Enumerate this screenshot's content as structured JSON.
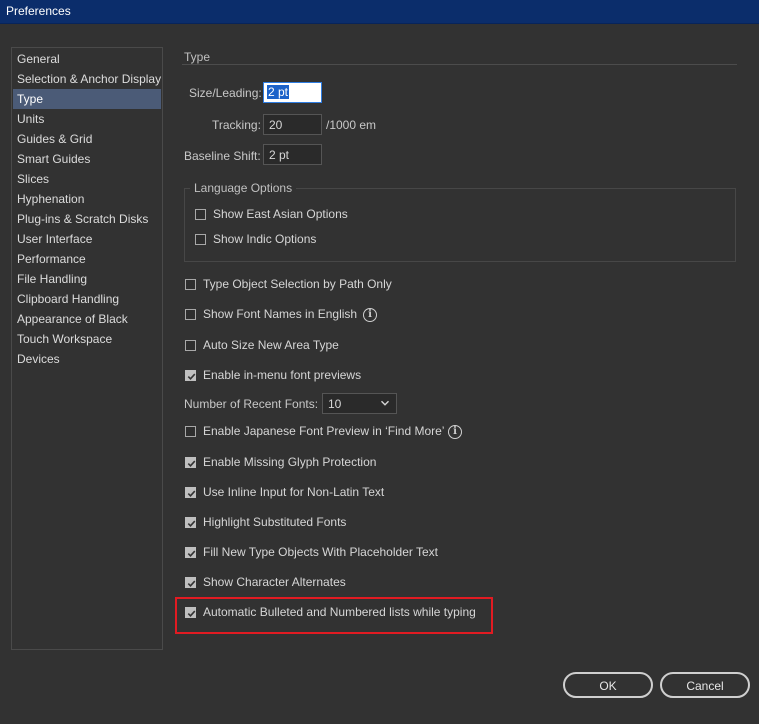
{
  "window": {
    "title": "Preferences"
  },
  "sidebar": {
    "items": [
      {
        "label": "General"
      },
      {
        "label": "Selection & Anchor Display"
      },
      {
        "label": "Type"
      },
      {
        "label": "Units"
      },
      {
        "label": "Guides & Grid"
      },
      {
        "label": "Smart Guides"
      },
      {
        "label": "Slices"
      },
      {
        "label": "Hyphenation"
      },
      {
        "label": "Plug-ins & Scratch Disks"
      },
      {
        "label": "User Interface"
      },
      {
        "label": "Performance"
      },
      {
        "label": "File Handling"
      },
      {
        "label": "Clipboard Handling"
      },
      {
        "label": "Appearance of Black"
      },
      {
        "label": "Touch Workspace"
      },
      {
        "label": "Devices"
      }
    ],
    "selected": "Type"
  },
  "type_section": {
    "title": "Type",
    "size_leading": {
      "label": "Size/Leading:",
      "value": "2 pt"
    },
    "tracking": {
      "label": "Tracking:",
      "value": "20",
      "unit": "/1000 em"
    },
    "baseline_shift": {
      "label": "Baseline Shift:",
      "value": "2 pt"
    }
  },
  "language_options": {
    "title": "Language Options",
    "east_asian": {
      "label": "Show East Asian Options",
      "checked": false
    },
    "indic": {
      "label": "Show Indic Options",
      "checked": false
    }
  },
  "options": {
    "type_object_selection": {
      "label": "Type Object Selection by Path Only",
      "checked": false
    },
    "font_names_english": {
      "label": "Show Font Names in English",
      "checked": false
    },
    "auto_size_area": {
      "label": "Auto Size New Area Type",
      "checked": false
    },
    "menu_font_previews": {
      "label": "Enable in-menu font previews",
      "checked": true
    },
    "recent_fonts": {
      "label": "Number of Recent Fonts:",
      "value": "10"
    },
    "japanese_font_preview": {
      "label": "Enable Japanese Font Preview in ‘Find More’",
      "checked": false
    },
    "missing_glyph": {
      "label": "Enable Missing Glyph Protection",
      "checked": true
    },
    "inline_input": {
      "label": "Use Inline Input for Non-Latin Text",
      "checked": true
    },
    "highlight_substituted": {
      "label": "Highlight Substituted Fonts",
      "checked": true
    },
    "fill_placeholder": {
      "label": "Fill New Type Objects With Placeholder Text",
      "checked": true
    },
    "character_alternates": {
      "label": "Show Character Alternates",
      "checked": true
    },
    "auto_bulleted": {
      "label": "Automatic Bulleted and Numbered lists while typing",
      "checked": true
    }
  },
  "buttons": {
    "ok": "OK",
    "cancel": "Cancel"
  },
  "colors": {
    "highlight_border": "#e11b22",
    "selection": "#4b5b77",
    "titlebar": "#0b2d6b"
  }
}
